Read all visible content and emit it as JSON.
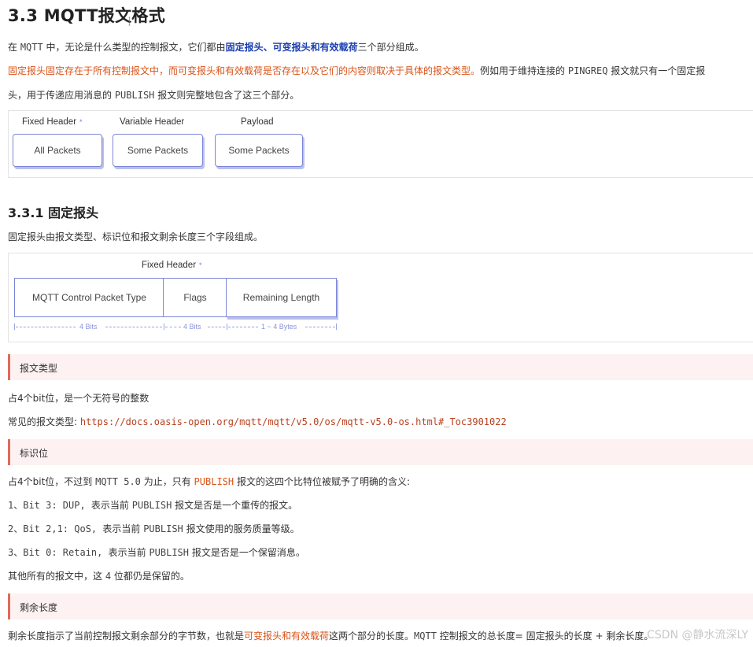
{
  "title": "3.3 MQTT报文格式",
  "intro": {
    "a": "在 ",
    "mqtt": "MQTT",
    "b": " 中，无论是什么类型的控制报文，它们都由",
    "highlight": "固定报头、可变报头和有效载荷",
    "c": "三个部分组成。"
  },
  "para2": {
    "orange": "固定报头固定存在于所有控制报文中，而可变报头和有效载荷是否存在以及它们的内容则取决于具体的报文类型。",
    "a": "例如用于维持连接的 ",
    "pingreq": "PINGREQ",
    "b": " 报文就只有一个固定报",
    "line2a": "头，用于传递应用消息的 ",
    "publish": "PUBLISH",
    "line2b": " 报文则完整地包含了这三个部分。"
  },
  "diagram1": {
    "headers": [
      "Fixed Header",
      "Variable Header",
      "Payload"
    ],
    "star": "*",
    "boxes": [
      "All Packets",
      "Some Packets",
      "Some Packets"
    ]
  },
  "subtitle": "3.3.1 固定报头",
  "fixed_intro": "固定报头由报文类型、标识位和报文剩余长度三个字段组成。",
  "diagram2": {
    "title": "Fixed Header",
    "star": "*",
    "cells": [
      "MQTT Control Packet Type",
      "Flags",
      "Remaining Length"
    ],
    "sizes": [
      "4 Bits",
      "4 Bits",
      "1 ~ 4 Bytes"
    ]
  },
  "callouts": [
    "报文类型",
    "标识位",
    "剩余长度"
  ],
  "type_desc": "占4个bit位，是一个无符号的整数",
  "common_types": {
    "label": "常见的报文类型: ",
    "url": "https://docs.oasis-open.org/mqtt/mqtt/v5.0/os/mqtt-v5.0-os.html#_Toc3901022"
  },
  "flags_desc": {
    "a": "占4个bit位，不过到 ",
    "mqtt": "MQTT 5.0",
    "b": " 为止，只有 ",
    "publish": "PUBLISH",
    "c": " 报文的这四个比特位被赋予了明确的含义:"
  },
  "bits": [
    {
      "code": "1、Bit 3: DUP, ",
      "text": "表示当前 ",
      "pub": "PUBLISH",
      "rest": " 报文是否是一个重传的报文。"
    },
    {
      "code": "2、Bit 2,1: QoS, ",
      "text": "表示当前 ",
      "pub": "PUBLISH",
      "rest": " 报文使用的服务质量等级。"
    },
    {
      "code": "3、Bit 0: Retain, ",
      "text": "表示当前 ",
      "pub": "PUBLISH",
      "rest": " 报文是否是一个保留消息。"
    }
  ],
  "reserved": {
    "a": "其他所有的报文中，这 ",
    "four": "4",
    "b": " 位都仍是保留的。"
  },
  "remaining": {
    "a": "剩余长度指示了当前控制报文剩余部分的字节数，也就是",
    "orange": "可变报头和有效载荷",
    "b": "这两个部分的长度。",
    "mqtt": "MQTT",
    "c": " 控制报文的总长度= 固定报头的长度 + 剩余长度。"
  },
  "watermark": "CSDN @静水流深LY",
  "colors": {
    "highlight": "#1a3fb0",
    "orange": "#d9541a",
    "diagram": "#7b86d8",
    "callout_bg": "#fdf2f1",
    "callout_bar": "#e06a5a"
  }
}
